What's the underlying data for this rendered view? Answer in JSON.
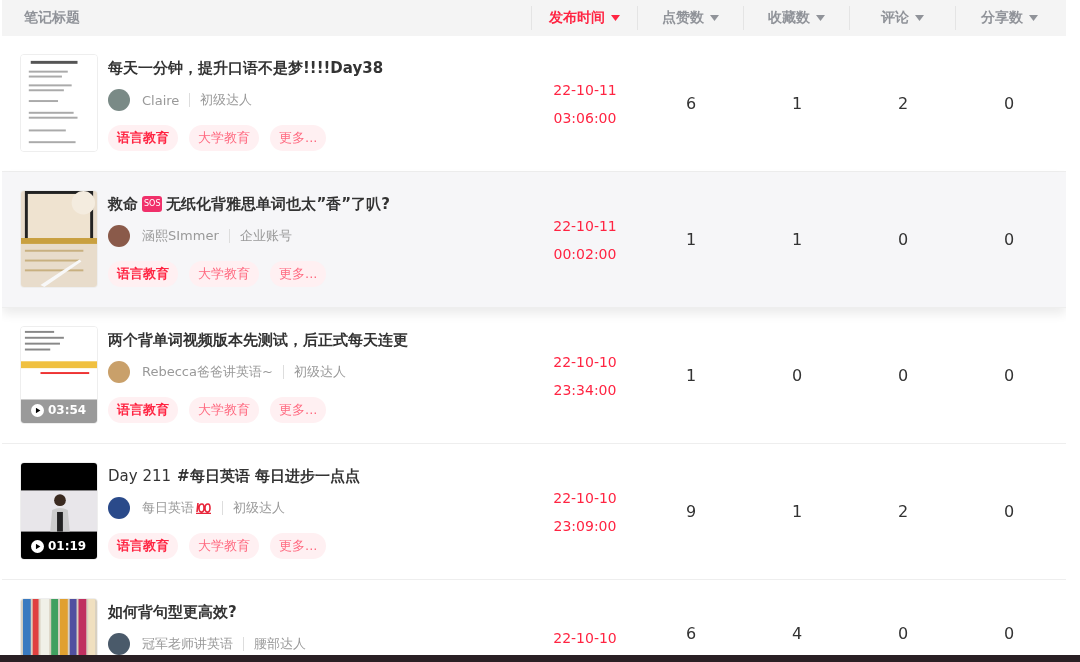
{
  "table": {
    "columns": [
      {
        "label": "笔记标题",
        "sortable": false,
        "selected": false
      },
      {
        "label": "发布时间",
        "sortable": true,
        "selected": true
      },
      {
        "label": "点赞数",
        "sortable": true,
        "selected": false
      },
      {
        "label": "收藏数",
        "sortable": true,
        "selected": false
      },
      {
        "label": "评论",
        "sortable": true,
        "selected": false
      },
      {
        "label": "分享数",
        "sortable": true,
        "selected": false
      }
    ],
    "rows": [
      {
        "highlighted": false,
        "thumb": {
          "kind": "document"
        },
        "title_parts": [
          {
            "kind": "bold",
            "text": "每天一分钟，提升口语不是梦!!!!Day38"
          }
        ],
        "author": "Claire",
        "hundred_badge": false,
        "level": "初级达人",
        "tags": [
          {
            "kind": "primary",
            "label": "语言教育"
          },
          {
            "kind": "secondary",
            "label": "大学教育"
          },
          {
            "kind": "more",
            "label": "更多..."
          }
        ],
        "date": "22-10-11",
        "time": "03:06:00",
        "likes": "6",
        "favorites": "1",
        "comments": "2",
        "shares": "0"
      },
      {
        "highlighted": true,
        "thumb": {
          "kind": "tablet"
        },
        "title_parts": [
          {
            "kind": "bold",
            "text": "救命"
          },
          {
            "kind": "badge",
            "text": "SOS"
          },
          {
            "kind": "bold",
            "text": "无纸化背雅思单词也太”香”了叭?"
          }
        ],
        "author": "涵熙SImmer",
        "hundred_badge": false,
        "level": "企业账号",
        "tags": [
          {
            "kind": "primary",
            "label": "语言教育"
          },
          {
            "kind": "secondary",
            "label": "大学教育"
          },
          {
            "kind": "more",
            "label": "更多..."
          }
        ],
        "date": "22-10-11",
        "time": "00:02:00",
        "likes": "1",
        "favorites": "1",
        "comments": "0",
        "shares": "0"
      },
      {
        "highlighted": false,
        "thumb": {
          "kind": "video-doc",
          "duration": "03:54"
        },
        "title_parts": [
          {
            "kind": "bold",
            "text": "两个背单词视频版本先测试，后正式每天连更"
          }
        ],
        "author": "Rebecca爸爸讲英语~",
        "hundred_badge": false,
        "level": "初级达人",
        "tags": [
          {
            "kind": "primary",
            "label": "语言教育"
          },
          {
            "kind": "secondary",
            "label": "大学教育"
          },
          {
            "kind": "more",
            "label": "更多..."
          }
        ],
        "date": "22-10-10",
        "time": "23:34:00",
        "likes": "1",
        "favorites": "0",
        "comments": "0",
        "shares": "0"
      },
      {
        "highlighted": false,
        "thumb": {
          "kind": "video-person",
          "duration": "01:19"
        },
        "title_parts": [
          {
            "kind": "plain",
            "text": "Day 211"
          },
          {
            "kind": "bold",
            "text": "#每日英语 每日进步一点点"
          }
        ],
        "author": "每日英语",
        "hundred_badge": true,
        "level": "初级达人",
        "tags": [
          {
            "kind": "primary",
            "label": "语言教育"
          },
          {
            "kind": "secondary",
            "label": "大学教育"
          },
          {
            "kind": "more",
            "label": "更多..."
          }
        ],
        "date": "22-10-10",
        "time": "23:09:00",
        "likes": "9",
        "favorites": "1",
        "comments": "2",
        "shares": "0"
      },
      {
        "highlighted": false,
        "thumb": {
          "kind": "books"
        },
        "title_parts": [
          {
            "kind": "bold",
            "text": "如何背句型更高效?"
          }
        ],
        "author": "冠军老师讲英语",
        "hundred_badge": false,
        "level": "腰部达人",
        "tags": [],
        "date": "22-10-10",
        "likes": "6",
        "favorites": "4",
        "comments": "0",
        "shares": "0"
      }
    ]
  }
}
